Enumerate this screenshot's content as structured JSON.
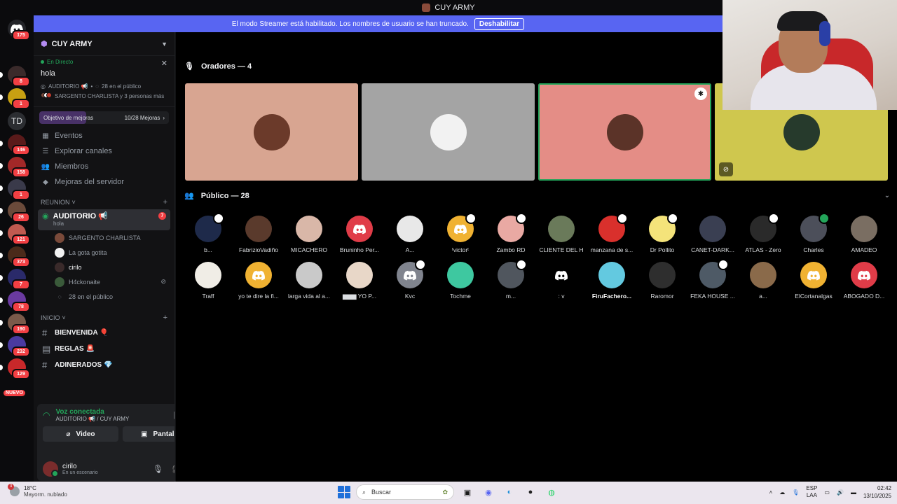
{
  "window": {
    "title": "CUY ARMY"
  },
  "banner": {
    "text": "El modo Streamer está habilitado. Los nombres de usuario se han truncado.",
    "button": "Deshabilitar"
  },
  "rail": {
    "badges": [
      "175",
      "8",
      "1",
      "146",
      "158",
      "1",
      "26",
      "121",
      "373",
      "7",
      "78",
      "190",
      "232",
      "129"
    ],
    "td": "TD",
    "nuevo": "NUEVO"
  },
  "server": {
    "name": "CUY ARMY",
    "live": {
      "status": "En Directo",
      "topic": "hola",
      "channel": "AUDITORIO 📢",
      "audience": "28 en el público",
      "speakers": "SARGENTO CHARLISTA y 3 personas más"
    },
    "boost": {
      "label": "Objetivo de mejoras",
      "progress": "10/28 Mejoras",
      "fill_fraction": 0.36
    },
    "nav": [
      "Eventos",
      "Explorar canales",
      "Miembros",
      "Mejoras del servidor"
    ],
    "categories": {
      "reunion": "REUNION",
      "inicio": "INICIO"
    },
    "voice_channel": {
      "name": "AUDITORIO 📢",
      "topic": "hola",
      "badge": "7"
    },
    "voice_users": [
      "SARGENTO CHARLISTA",
      "La gota gotita",
      "cirilo",
      "H4ckonaite"
    ],
    "voice_audience": "28 en el público",
    "channels": [
      "BIENVENIDA 🎈",
      "REGLAS 🚨",
      "ADINERADOS 💎"
    ]
  },
  "voice_panel": {
    "status": "Voz conectada",
    "location": "AUDITORIO 📢 / CUY ARMY",
    "video": "Video",
    "screen": "Pantalla",
    "user": "cirilo",
    "user_status": "En un escenario"
  },
  "stage": {
    "speakers_header": "Oradores — 4",
    "audience_header": "Público — 28",
    "speakers": [
      {
        "color": "#d8a591",
        "avatar": "#6b3a2a"
      },
      {
        "color": "#a4a4a4",
        "avatar": "#f2f2f2"
      },
      {
        "color": "#e48d86",
        "avatar": "#5b3328",
        "speaking": true,
        "moderator": true
      },
      {
        "color": "#cfc74e",
        "avatar": "#263a2c",
        "muted": true
      }
    ],
    "audience": [
      {
        "name": "b...",
        "color": "#1e2a4a",
        "badge": "white"
      },
      {
        "name": "FabrizioVadiño",
        "color": "#5a3a2c"
      },
      {
        "name": "MICACHERO",
        "color": "#d9b7a8"
      },
      {
        "name": "Bruninho Per...",
        "color": "#e03c48",
        "discord": true
      },
      {
        "name": "A...",
        "color": "#e8e8e8"
      },
      {
        "name": "ᵗvictorᵗ",
        "color": "#f0b232",
        "discord": true,
        "badge": "white"
      },
      {
        "name": "Zambo RD",
        "color": "#e9a9a3",
        "badge": "white"
      },
      {
        "name": "CLIENTE DEL H",
        "color": "#6a7a5a"
      },
      {
        "name": "manzana de s...",
        "color": "#d9302c",
        "badge": "white"
      },
      {
        "name": "Dr Pollito",
        "color": "#f4e37a",
        "badge": "white"
      },
      {
        "name": "CANET-DARK...",
        "color": "#3a3f52"
      },
      {
        "name": "ATLAS - Zero",
        "color": "#2a2a2a",
        "badge": "white"
      },
      {
        "name": "Charles",
        "color": "#4c4f5a",
        "badge": "green"
      },
      {
        "name": "AMADEO",
        "color": "#7a6e62"
      },
      {
        "name": "Traff",
        "color": "#f0ede6"
      },
      {
        "name": "yo te dire la fi...",
        "color": "#f0b232",
        "discord": true
      },
      {
        "name": "larga vida al a...",
        "color": "#c9c9c9"
      },
      {
        "name": "▆▆▆ YO P...",
        "color": "#e8d7c8"
      },
      {
        "name": "Kvc",
        "color": "#80848e",
        "discord": true,
        "badge": "white"
      },
      {
        "name": "Tochme",
        "color": "#3ec8a0"
      },
      {
        "name": "m...",
        "color": "#50565e",
        "badge": "white"
      },
      {
        "name": ": v",
        "color": "#000000",
        "discord": true
      },
      {
        "name": "FiruFachero...",
        "color": "#63c9e0",
        "bold": true
      },
      {
        "name": "Raromor",
        "color": "#2e2e2e"
      },
      {
        "name": "FEKA HOUSE ...",
        "color": "#4e5a66",
        "badge": "white"
      },
      {
        "name": "a...",
        "color": "#8a6a4a"
      },
      {
        "name": "ElCortanalgas",
        "color": "#f0b232",
        "discord": true
      },
      {
        "name": "ABOGADO D...",
        "color": "#e03c48",
        "discord": true
      }
    ]
  },
  "taskbar": {
    "weather_temp": "18°C",
    "weather_desc": "Mayorm. nublado",
    "weather_badge": "3",
    "search": "Buscar",
    "lang1": "ESP",
    "lang2": "LAA",
    "time": "02:42",
    "date": "13/10/2025"
  }
}
